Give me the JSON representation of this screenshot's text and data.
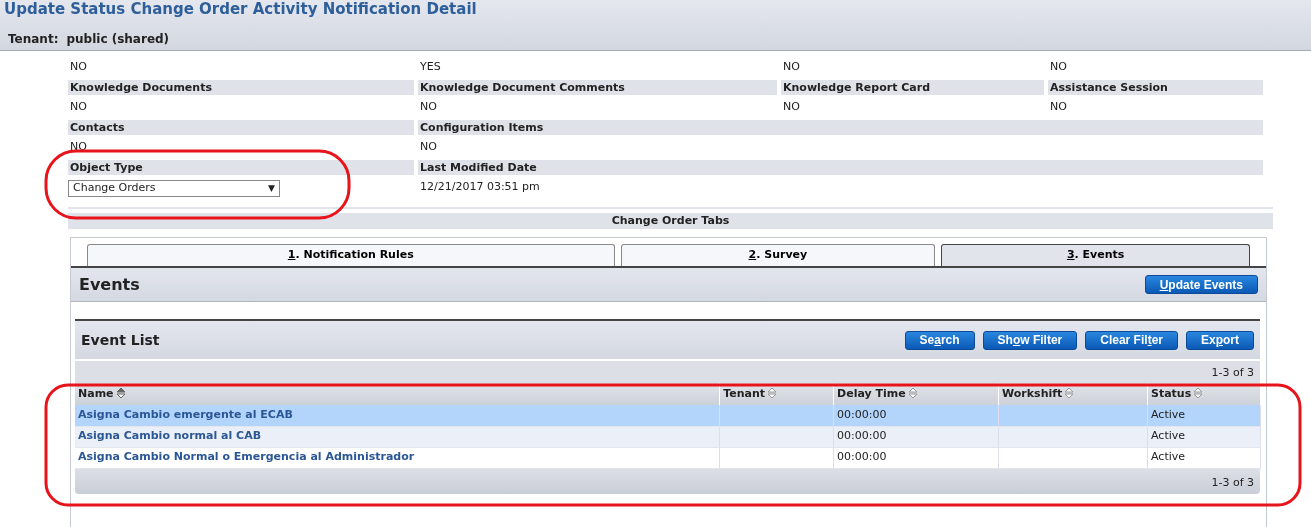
{
  "page": {
    "title": "Update Status Change Order Activity Notification Detail",
    "tenant_label": "Tenant:",
    "tenant_value": "public (shared)"
  },
  "field_grid": [
    {
      "kind": "values",
      "cells": [
        "NO",
        "YES",
        "NO",
        "NO"
      ]
    },
    {
      "kind": "labels",
      "cells": [
        "Knowledge Documents",
        "Knowledge Document Comments",
        "Knowledge Report Card",
        "Assistance Session"
      ]
    },
    {
      "kind": "values",
      "cells": [
        "NO",
        "NO",
        "NO",
        "NO"
      ]
    },
    {
      "kind": "labels",
      "cells": [
        "Contacts",
        "Configuration Items"
      ]
    },
    {
      "kind": "values",
      "cells": [
        "NO",
        "NO"
      ]
    },
    {
      "kind": "labels",
      "cells": [
        "Object Type",
        "Last Modified Date"
      ]
    },
    {
      "kind": "controls",
      "cells": [
        {
          "kind": "select",
          "value": "Change Orders",
          "arrow": "▼",
          "outlined": true
        },
        {
          "kind": "text",
          "value": "12/21/2017 03:51 pm"
        }
      ]
    }
  ],
  "section_title": "Change Order Tabs",
  "tabs": [
    {
      "key": "1",
      "rest": ". Notification Rules",
      "selected": false
    },
    {
      "key": "2",
      "rest": ". Survey",
      "selected": false
    },
    {
      "key": "3",
      "rest": ". Events",
      "selected": true
    }
  ],
  "events_panel": {
    "title": "Events",
    "button": {
      "key": "U",
      "after": "pdate Events"
    }
  },
  "event_list": {
    "title": "Event List",
    "outlined": true,
    "buttons": [
      {
        "before": "Se",
        "key": "a",
        "after": "rch"
      },
      {
        "before": "Sh",
        "key": "o",
        "after": "w Filter"
      },
      {
        "before": "Clear Fil",
        "key": "t",
        "after": "er"
      },
      {
        "before": "Ex",
        "key": "p",
        "after": "ort"
      }
    ],
    "pager_top": "1-3 of 3",
    "columns": [
      {
        "label": "Name",
        "sorted": true
      },
      {
        "label": "Tenant",
        "sorted": false
      },
      {
        "label": "Delay Time",
        "sorted": false
      },
      {
        "label": "Workshift",
        "sorted": false
      },
      {
        "label": "Status",
        "sorted": false
      }
    ],
    "rows": [
      {
        "selected": true,
        "cells": [
          "Asigna Cambio emergente al ECAB",
          null,
          "00:00:00",
          null,
          "Active"
        ]
      },
      {
        "selected": false,
        "cells": [
          "Asigna Cambio normal al CAB",
          null,
          "00:00:00",
          null,
          "Active"
        ]
      },
      {
        "selected": false,
        "cells": [
          "Asigna Cambio Normal o Emergencia al Administrador",
          null,
          "00:00:00",
          null,
          "Active"
        ]
      }
    ],
    "pager_bottom": "1-3 of 3"
  }
}
